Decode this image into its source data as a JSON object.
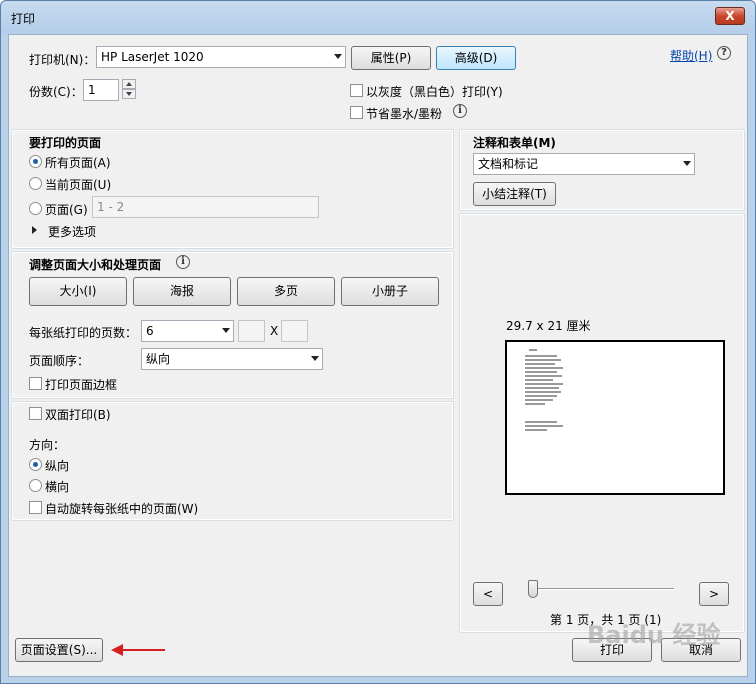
{
  "window": {
    "title": "打印",
    "close_glyph": "X"
  },
  "printer": {
    "label": "打印机(N)：",
    "selected": "HP LaserJet 1020",
    "properties_button": "属性(P)",
    "advanced_button": "高级(D)",
    "help_link": "帮助(H)",
    "help_icon": "?"
  },
  "copies": {
    "label": "份数(C)：",
    "value": "1"
  },
  "options": {
    "grayscale": "以灰度（黑白色）打印(Y)",
    "save_ink": "节省墨水/墨粉"
  },
  "pages_to_print": {
    "title": "要打印的页面",
    "all": "所有页面(A)",
    "current": "当前页面(U)",
    "pages": "页面(G)",
    "pages_placeholder": "1 - 2",
    "more": "更多选项"
  },
  "sizing": {
    "title": "调整页面大小和处理页面",
    "buttons": [
      "大小(I)",
      "海报",
      "多页",
      "小册子"
    ],
    "pages_per_sheet_label": "每张纸打印的页数：",
    "pages_per_sheet_value": "6",
    "x_label": "X",
    "page_order_label": "页面顺序：",
    "page_order_value": "纵向",
    "print_border": "打印页面边框"
  },
  "duplex": {
    "label": "双面打印(B)",
    "orientation_label": "方向：",
    "portrait": "纵向",
    "landscape": "横向",
    "auto_rotate": "自动旋转每张纸中的页面(W)"
  },
  "comments": {
    "title": "注释和表单(M)",
    "selected": "文档和标记",
    "summarize_button": "小结注释(T)"
  },
  "preview": {
    "size_label": "29.7 x 21 厘米",
    "prev_button": "<",
    "next_button": ">",
    "page_info": "第 1 页，共 1 页 (1)"
  },
  "footer": {
    "page_setup_button": "页面设置(S)...",
    "print_button": "打印",
    "cancel_button": "取消"
  },
  "watermark": {
    "text": "Baidu 经验"
  },
  "colors": {
    "accent_blue": "#1f5fa9",
    "annotation_arrow": "#d61f1f"
  }
}
